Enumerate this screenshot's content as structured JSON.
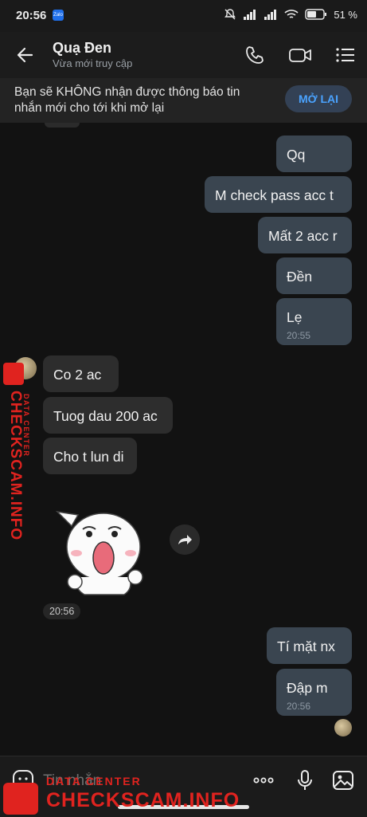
{
  "status_bar": {
    "time": "20:56",
    "app_badge": "Zalo",
    "battery": "51 %"
  },
  "header": {
    "title": "Quạ Đen",
    "subtitle": "Vừa mới truy cập"
  },
  "notice": {
    "text": "Bạn sẽ KHÔNG nhận được thông báo tin nhắn mới cho tới khi mở lại",
    "button": "MỞ LẠI"
  },
  "messages": [
    {
      "dir": "out",
      "text": "Qq"
    },
    {
      "dir": "out",
      "text": "M check pass acc t"
    },
    {
      "dir": "out",
      "text": "Mất 2 acc r"
    },
    {
      "dir": "out",
      "text": "Đền"
    },
    {
      "dir": "out",
      "text": "Lẹ",
      "time": "20:55"
    },
    {
      "dir": "in",
      "text": "Co 2 ac"
    },
    {
      "dir": "in",
      "text": "Tuog dau 200 ac"
    },
    {
      "dir": "in",
      "text": "Cho t lun di"
    },
    {
      "dir": "in",
      "type": "sticker",
      "time": "20:56"
    },
    {
      "dir": "out",
      "text": "Tí mặt nx"
    },
    {
      "dir": "out",
      "text": "Đập m",
      "time": "20:56"
    }
  ],
  "composer": {
    "placeholder": "Tin nhắn"
  },
  "icons": [
    "back-arrow-icon",
    "phone-icon",
    "video-call-icon",
    "menu-icon",
    "share-icon",
    "sticker-icon",
    "more-icon",
    "microphone-icon",
    "image-icon"
  ],
  "watermark": {
    "main": "CHECKSCAM.INFO",
    "sub": "DATA CENTER"
  },
  "colors": {
    "outgoing_bubble": "#3a4550",
    "incoming_bubble": "#2d2d2d",
    "accent": "#4aa3ff",
    "watermark": "#e0231f"
  }
}
